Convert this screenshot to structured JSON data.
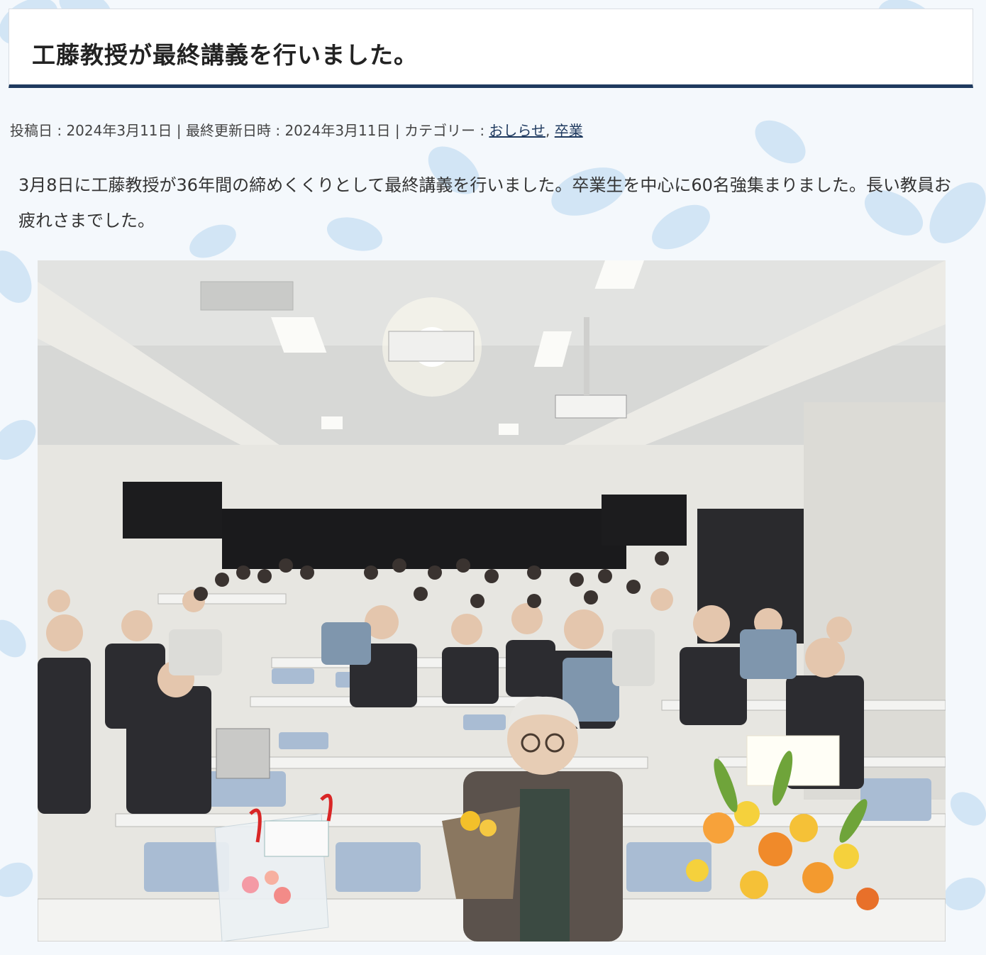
{
  "post": {
    "title": "工藤教授が最終講義を行いました。",
    "meta": {
      "posted_label": "投稿日 : ",
      "posted_date": "2024年3月11日",
      "sep1": " | ",
      "updated_label": "最終更新日時 : ",
      "updated_date": "2024年3月11日",
      "sep2": " | ",
      "category_label": "カテゴリー : ",
      "categories": [
        "おしらせ",
        "卒業"
      ],
      "category_sep": ", "
    },
    "body": "3月8日に工藤教授が36年間の締めくくりとして最終講義を行いました。卒業生を中心に60名強集まりました。長い教員お疲れさまでした。"
  },
  "colors": {
    "accent_border": "#1f3a5f",
    "leaf": "#a9cdea",
    "link": "#1f3a5f"
  }
}
